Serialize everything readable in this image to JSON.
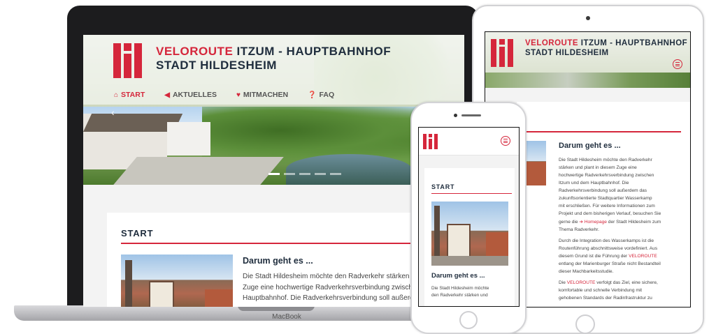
{
  "site": {
    "title_accent": "VELOROUTE",
    "title_rest": " ITZUM - HAUPTBAHNHOF",
    "subtitle": "STADT HILDESHEIM"
  },
  "nav": {
    "items": [
      {
        "label": "START",
        "icon": "home-icon",
        "active": true
      },
      {
        "label": "AKTUELLES",
        "icon": "megaphone-icon",
        "active": false
      },
      {
        "label": "MITMACHEN",
        "icon": "heart-icon",
        "active": false
      },
      {
        "label": "FAQ",
        "icon": "question-icon",
        "active": false
      }
    ]
  },
  "section": {
    "title": "START"
  },
  "article": {
    "title": "Darum geht es ...",
    "laptop_lines": [
      "Die Stadt Hildesheim möchte den Radverkehr stärken und",
      "Zuge eine hochwertige Radverkehrsverbindung zwischen",
      "Hauptbahnhof. Die Radverkehrsverbindung soll außerdem"
    ],
    "tablet_p1_lines": [
      "Die Stadt Hildesheim möchte den Radverkehr",
      "stärken und plant in diesem Zuge eine",
      "hochwertige Radverkehrsverbindung zwischen",
      "Itzum und dem Hauptbahnhof. Die",
      "Radverkehrsverbindung soll außerdem das",
      "zukunftsorientierte Stadtquartier Wasserkamp",
      "mit erschließen. Für weitere Informationen zum",
      "Projekt und dem bisherigen Verlauf, besuchen Sie"
    ],
    "tablet_link_pre": "gerne die ",
    "tablet_link_arrow": "➔",
    "tablet_link": " Homepage",
    "tablet_link_post": " der Stadt Hildesheim zum",
    "tablet_p1_last": "Thema Radverkehr.",
    "tablet_p2_lines_a": [
      "Durch die Integration des Wasserkamps ist die",
      "Routenführung abschnittsweise vordefiniert. Aus"
    ],
    "tablet_p2_pre": "diesem Grund ist die Führung der ",
    "tablet_p2_accent": "VELOROUTE",
    "tablet_p2_lines_b": [
      "entlang der Marienburger Straße nicht Bestandteil",
      "dieser Machbarkeitsstudie."
    ],
    "tablet_p3_pre": "Die ",
    "tablet_p3_accent": "VELOROUTE",
    "tablet_p3_post": " verfolgt das Ziel, eine sichere,",
    "tablet_p3_lines": [
      "komfortable und schnelle Verbindung mit",
      "gehobenen Standards der Radinfrastruktur zu"
    ],
    "phone_lines": [
      "Die Stadt Hildesheim möchte",
      "den Radverkehr stärken und"
    ]
  },
  "device": {
    "laptop_brand": "MacBook"
  },
  "colors": {
    "accent": "#d5263b",
    "heading": "#1f2d3d",
    "background": "#f3f3f3"
  }
}
